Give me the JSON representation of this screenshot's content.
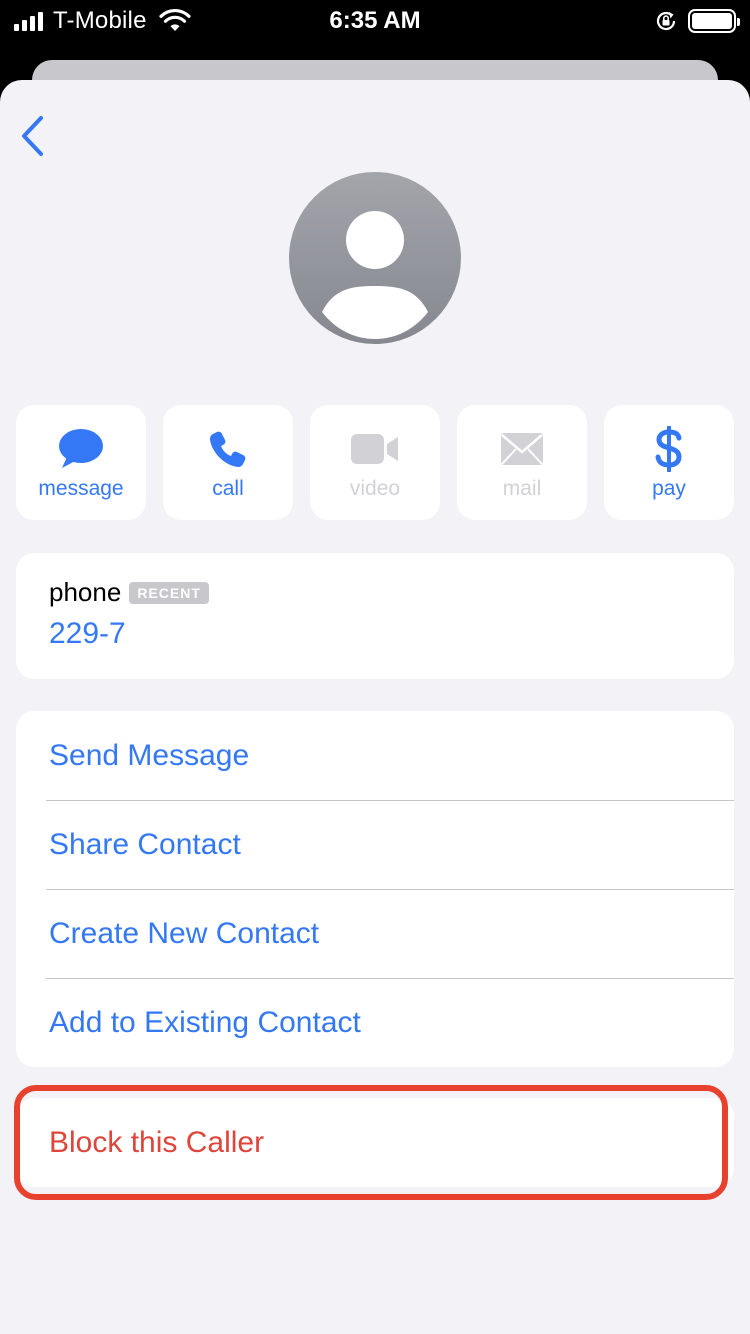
{
  "status_bar": {
    "carrier": "T-Mobile",
    "time": "6:35 AM",
    "icons": [
      "signal-icon",
      "wifi-icon",
      "orientation-lock-icon",
      "battery-icon"
    ]
  },
  "nav": {
    "back_icon": "chevron-left-icon"
  },
  "avatar": {
    "icon": "person-silhouette-icon"
  },
  "actions": [
    {
      "label": "message",
      "icon": "message-bubble-icon",
      "enabled": true
    },
    {
      "label": "call",
      "icon": "phone-icon",
      "enabled": true
    },
    {
      "label": "video",
      "icon": "video-camera-icon",
      "enabled": false
    },
    {
      "label": "mail",
      "icon": "envelope-icon",
      "enabled": false
    },
    {
      "label": "pay",
      "icon": "dollar-icon",
      "enabled": true
    }
  ],
  "phone": {
    "label": "phone",
    "badge": "RECENT",
    "number": "229-7"
  },
  "options": [
    {
      "label": "Send Message"
    },
    {
      "label": "Share Contact"
    },
    {
      "label": "Create New Contact"
    },
    {
      "label": "Add to Existing Contact"
    }
  ],
  "block": {
    "label": "Block this Caller"
  },
  "colors": {
    "accent": "#3478f6",
    "destructive": "#e0443a",
    "highlight": "#e8422f",
    "background": "#f2f2f7",
    "disabled": "#d1d1d6"
  }
}
